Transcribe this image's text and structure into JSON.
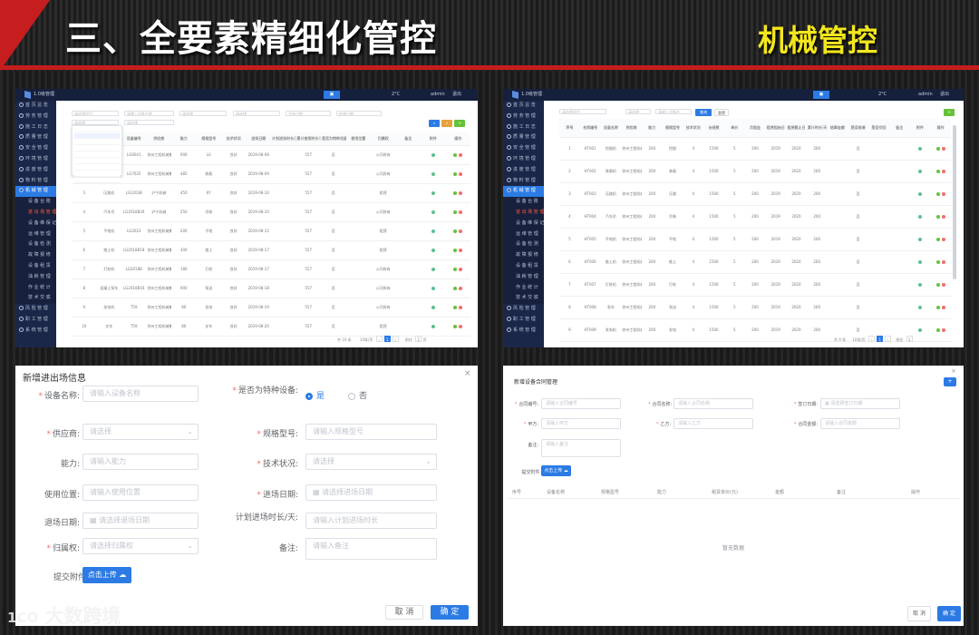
{
  "header": {
    "title": "三、全要素精细化管控",
    "subtitle": "机械管控"
  },
  "watermark": {
    "logo": "1CO",
    "text": "大数跨境"
  },
  "app": {
    "sidebar": [
      {
        "label": "首 页 总 览",
        "type": "main"
      },
      {
        "label": "劳 务 管 理",
        "type": "main"
      },
      {
        "label": "施 工 日 志",
        "type": "main"
      },
      {
        "label": "质 量 管 理",
        "type": "main"
      },
      {
        "label": "安 全 管 理",
        "type": "main"
      },
      {
        "label": "环 境 管 理",
        "type": "main"
      },
      {
        "label": "进 度 管 理",
        "type": "main"
      },
      {
        "label": "物 料 管 理",
        "type": "main"
      },
      {
        "label": "机 械 管 理",
        "type": "active"
      },
      {
        "label": "设 备 台 账",
        "type": "sub"
      },
      {
        "label": "进 出 场 管 理",
        "type": "sub"
      },
      {
        "label": "设 备 维 保 记 录",
        "type": "sub"
      },
      {
        "label": "运 维 管 理",
        "type": "sub"
      },
      {
        "label": "设 备 检 测",
        "type": "sub"
      },
      {
        "label": "故 障 报 修",
        "type": "sub"
      },
      {
        "label": "设 备 租 赁",
        "type": "sub"
      },
      {
        "label": "油 耗 管 理",
        "type": "sub"
      },
      {
        "label": "作 业 统 计",
        "type": "sub"
      },
      {
        "label": "技 术 交 底",
        "type": "sub"
      },
      {
        "label": "风 险 管 理",
        "type": "main"
      },
      {
        "label": "职 工 管 理",
        "type": "main"
      },
      {
        "label": "系 统 管 理",
        "type": "main"
      }
    ],
    "left_highlight_index": 10,
    "right_highlight_index": 10,
    "topbar": {
      "logo": "1.0级管理",
      "right": "2°C",
      "user": "admin",
      "logout": "退出"
    },
    "table_left": {
      "headers": [
        "序号",
        "设备名称",
        "设备编号",
        "供应商",
        "能力",
        "规格型号",
        "技术状况",
        "进场日期",
        "计划进场时长/天",
        "累计使用时长/天",
        "是否为特种设备",
        "使用位置",
        "归属权",
        "备注",
        "附件",
        "操作"
      ],
      "rows": [
        [
          "1",
          "挖掘机",
          "LG6041",
          "徐州工程机械集团有限公司",
          "900",
          "LG",
          "良好",
          "2019-08-08",
          "",
          "557",
          "否",
          "",
          "公司所有",
          "",
          "",
          ""
        ],
        [
          "2",
          "装载机",
          "LG7025",
          "徐州工程机械集团有限公司",
          "485",
          "装载",
          "良好",
          "2019-08-09",
          "",
          "557",
          "否",
          "",
          "公司所有",
          "",
          "",
          ""
        ],
        [
          "3",
          "压路机",
          "LG2203B",
          "沪宁机械",
          "450",
          "6Y",
          "良好",
          "2019-08-10",
          "",
          "557",
          "否",
          "",
          "租赁",
          "",
          "",
          ""
        ],
        [
          "4",
          "汽车吊",
          "LG2018B29",
          "沪宁机械",
          "250",
          "吊装",
          "良好",
          "2019-08-10",
          "",
          "557",
          "否",
          "",
          "公司所有",
          "",
          "",
          ""
        ],
        [
          "5",
          "平地机",
          "LG2023",
          "徐州工程机械集团有限公司",
          "200",
          "平地",
          "良好",
          "2019-08-12",
          "",
          "557",
          "否",
          "",
          "租赁",
          "",
          "",
          ""
        ],
        [
          "6",
          "推土机",
          "LG2018B18",
          "徐州工程机械集团有限公司",
          "300",
          "推土",
          "良好",
          "2019-08-17",
          "",
          "557",
          "否",
          "",
          "租赁",
          "",
          "",
          ""
        ],
        [
          "7",
          "打桩机",
          "LG2018B",
          "徐州工程机械集团有限公司",
          "180",
          "打桩",
          "良好",
          "2019-08-17",
          "",
          "557",
          "否",
          "",
          "公司所有",
          "",
          "",
          ""
        ],
        [
          "8",
          "混凝土泵车",
          "LG2018B16",
          "徐州工程机械集团有限公司",
          "900",
          "泵送",
          "良好",
          "2019-08-18",
          "",
          "557",
          "否",
          "",
          "公司所有",
          "",
          "",
          ""
        ],
        [
          "9",
          "发电机",
          "T59",
          "徐州工程机械集团有限公司",
          "80",
          "发电",
          "良好",
          "2019-08-19",
          "",
          "557",
          "否",
          "",
          "公司所有",
          "",
          "",
          ""
        ],
        [
          "10",
          "叉车",
          "T59",
          "徐州工程机械集团有限公司",
          "80",
          "叉车",
          "良好",
          "2019-08-20",
          "",
          "557",
          "否",
          "",
          "租赁",
          "",
          "",
          ""
        ]
      ],
      "pagination": {
        "total": "共 10 条",
        "size": "10条/页",
        "page": "1",
        "goto": "前往",
        "unit": "页"
      }
    },
    "table_right": {
      "headers": [
        "序号",
        "合同编号",
        "设备名称",
        "供应商",
        "能力",
        "规格型号",
        "技术状况",
        "台班数",
        "单价",
        "月租金",
        "租赁起始日",
        "租赁截止日",
        "累计时长/天",
        "结算金额",
        "是否结清",
        "是否交回",
        "备注",
        "附件",
        "操作"
      ],
      "rows": [
        [
          "1",
          "HT001",
          "挖掘机",
          "徐州工程机械集团有限公司",
          "200",
          "挖掘",
          "4",
          "1500",
          "5",
          "200",
          "2019",
          "2020",
          "200",
          "",
          "否",
          "",
          "",
          "",
          ""
        ],
        [
          "2",
          "HT002",
          "装载机",
          "徐州工程机械集团有限公司",
          "200",
          "装载",
          "4",
          "1500",
          "5",
          "200",
          "2019",
          "2020",
          "200",
          "",
          "否",
          "",
          "",
          "",
          ""
        ],
        [
          "3",
          "HT003",
          "压路机",
          "徐州工程机械集团有限公司",
          "200",
          "压路",
          "4",
          "1500",
          "5",
          "200",
          "2019",
          "2020",
          "200",
          "",
          "否",
          "",
          "",
          "",
          ""
        ],
        [
          "4",
          "HT004",
          "汽车吊",
          "徐州工程机械集团有限公司",
          "200",
          "吊装",
          "4",
          "1500",
          "5",
          "200",
          "2019",
          "2020",
          "200",
          "",
          "否",
          "",
          "",
          "",
          ""
        ],
        [
          "5",
          "HT005",
          "平地机",
          "徐州工程机械集团有限公司",
          "200",
          "平地",
          "4",
          "1500",
          "5",
          "200",
          "2019",
          "2020",
          "200",
          "",
          "否",
          "",
          "",
          "",
          ""
        ],
        [
          "6",
          "HT006",
          "推土机",
          "徐州工程机械集团有限公司",
          "200",
          "推土",
          "4",
          "1500",
          "5",
          "200",
          "2019",
          "2020",
          "200",
          "",
          "否",
          "",
          "",
          "",
          ""
        ],
        [
          "7",
          "HT007",
          "打桩机",
          "徐州工程机械集团有限公司",
          "200",
          "打桩",
          "4",
          "1500",
          "5",
          "200",
          "2019",
          "2020",
          "200",
          "",
          "否",
          "",
          "",
          "",
          ""
        ],
        [
          "8",
          "HT008",
          "泵车",
          "徐州工程机械集团有限公司",
          "200",
          "泵送",
          "4",
          "1500",
          "5",
          "200",
          "2019",
          "2020",
          "200",
          "",
          "否",
          "",
          "",
          "",
          ""
        ],
        [
          "9",
          "HT009",
          "发电机",
          "徐州工程机械集团有限公司",
          "200",
          "发电",
          "4",
          "1500",
          "5",
          "200",
          "2019",
          "2020",
          "200",
          "",
          "否",
          "",
          "",
          "",
          ""
        ]
      ],
      "pagination": {
        "total": "共 9 条",
        "size": "10条/页",
        "page": "1",
        "goto": "前往",
        "unit": "页"
      }
    }
  },
  "form_left": {
    "title": "新增进出场信息",
    "fields": [
      {
        "label": "设备名称:",
        "placeholder": "请输入设备名称",
        "required": true
      },
      {
        "label": "是否为特种设备:",
        "required": true,
        "radio_yes": "是",
        "radio_no": "否"
      },
      {
        "label": "供应商:",
        "placeholder": "请选择",
        "required": true,
        "select": true
      },
      {
        "label": "规格型号:",
        "placeholder": "请输入规格型号",
        "required": true
      },
      {
        "label": "能力:",
        "placeholder": "请输入能力"
      },
      {
        "label": "技术状况:",
        "placeholder": "请选择",
        "required": true,
        "select": true
      },
      {
        "label": "使用位置:",
        "placeholder": "请输入使用位置"
      },
      {
        "label": "进场日期:",
        "placeholder": "请选择进场日期",
        "required": true
      },
      {
        "label": "退场日期:",
        "placeholder": "请选择退场日期"
      },
      {
        "label": "计划进场时长/天:",
        "placeholder": "请输入计划进场时长"
      },
      {
        "label": "归属权:",
        "placeholder": "请选择归属权",
        "required": true,
        "select": true
      },
      {
        "label": "备注:",
        "placeholder": "请输入备注"
      }
    ],
    "attach_label": "提交附件:",
    "upload_label": "点击上传",
    "cancel": "取 消",
    "confirm": "确 定"
  },
  "form_right": {
    "title": "新增设备合同管理",
    "fields": [
      {
        "label": "合同编号:",
        "placeholder": "请输入合同编号",
        "required": true
      },
      {
        "label": "合同名称:",
        "placeholder": "请输入合同名称",
        "required": true
      },
      {
        "label": "签订日期:",
        "placeholder": "请选择签订日期",
        "required": true
      },
      {
        "label": "甲方:",
        "placeholder": "请输入甲方",
        "required": true
      },
      {
        "label": "乙方:",
        "placeholder": "请输入乙方",
        "required": true
      },
      {
        "label": "合同金额:",
        "placeholder": "请输入合同金额",
        "required": true
      },
      {
        "label": "备注:",
        "placeholder": "请输入备注"
      }
    ],
    "attach_label": "提交附件:",
    "upload_label": "点击上传",
    "add_button": "+",
    "table_headers": [
      "序号",
      "设备名称",
      "规格型号",
      "能力",
      "租赁单价(元)",
      "金额",
      "备注",
      "操作"
    ],
    "empty": "暂无数据",
    "cancel": "取 消",
    "confirm": "确 定"
  }
}
